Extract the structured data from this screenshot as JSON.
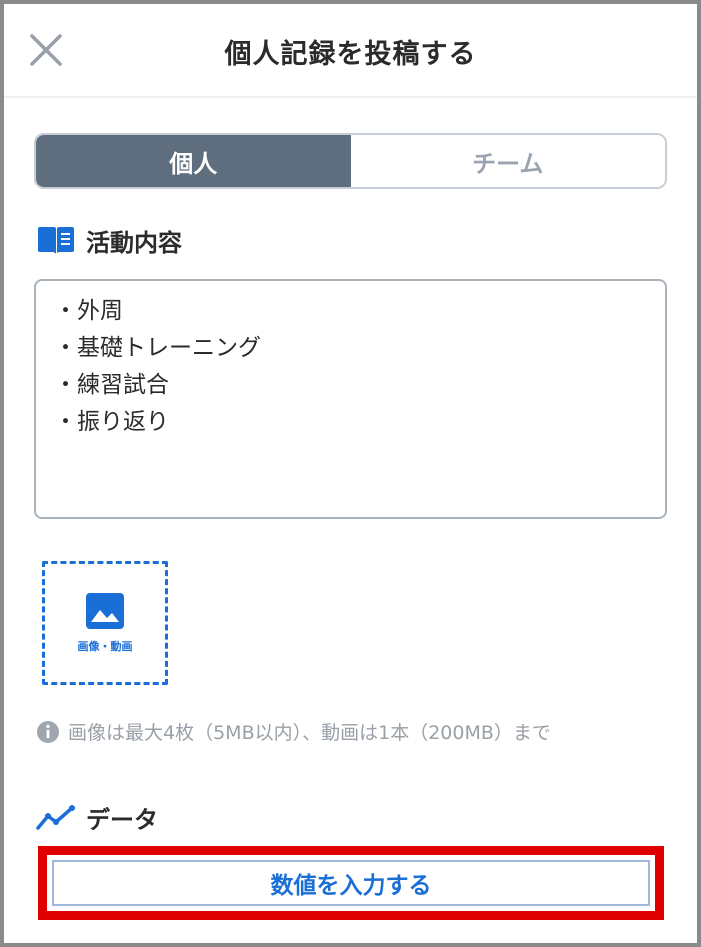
{
  "header": {
    "title": "個人記録を投稿する",
    "close_icon": "close-icon"
  },
  "segment": {
    "options": [
      {
        "label": "個人",
        "selected": true
      },
      {
        "label": "チーム",
        "selected": false
      }
    ]
  },
  "activity": {
    "heading": "活動内容",
    "icon": "book-icon",
    "lines": [
      "・外周",
      "・基礎トレーニング",
      "・練習試合",
      "・振り返り"
    ]
  },
  "media": {
    "label": "画像・動画",
    "icon": "image-icon"
  },
  "note": {
    "icon": "info-icon",
    "text": "画像は最大4枚（5MB以内）、動画は1本（200MB）まで"
  },
  "data_section": {
    "heading": "データ",
    "icon": "line-chart-icon",
    "button_label": "数値を入力する"
  },
  "colors": {
    "accent": "#1a6fd6",
    "segment_active": "#5f6e7e",
    "highlight": "#e10000"
  }
}
